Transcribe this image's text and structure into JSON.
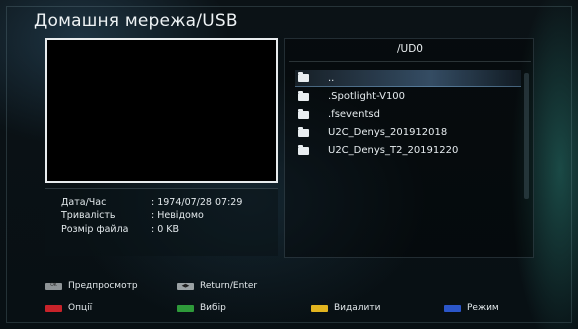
{
  "title": "Домашня мережа/USB",
  "file_info": {
    "date_label": "Дата/Час",
    "date_value": ": 1974/07/28 07:29",
    "duration_label": "Тривалість",
    "duration_value": ": Невідомо",
    "size_label": "Розмір файла",
    "size_value": ": 0 KB"
  },
  "browser": {
    "path": "/UD0",
    "items": [
      {
        "name": "..",
        "icon": "folder-icon",
        "selected": true
      },
      {
        "name": ".Spotlight-V100",
        "icon": "folder-icon"
      },
      {
        "name": ".fseventsd",
        "icon": "folder-icon"
      },
      {
        "name": "U2C_Denys_201912018",
        "icon": "folder-icon"
      },
      {
        "name": "U2C_Denys_T2_20191220",
        "icon": "folder-icon"
      }
    ]
  },
  "hints": {
    "ok_key": "OK",
    "preview": "Предпросмотр",
    "arrows_key": "◀▶",
    "return_enter": "Return/Enter",
    "red": "Опції",
    "green": "Вибір",
    "yellow": "Видалити",
    "blue": "Режим"
  },
  "colors": {
    "red": "#c8232a",
    "green": "#2e9a3a",
    "yellow": "#e2b41f",
    "blue": "#2b56c9"
  }
}
